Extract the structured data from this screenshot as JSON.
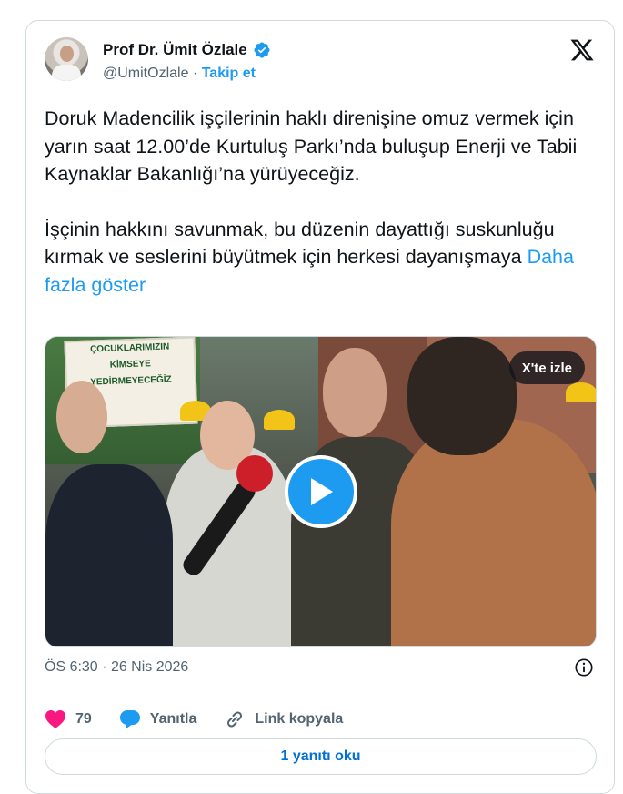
{
  "author": {
    "name": "Prof Dr. Ümit Özlale",
    "handle": "@UmitOzlale",
    "separator": "·",
    "follow_label": "Takip et",
    "verified_icon": "verified-badge-icon"
  },
  "tweet": {
    "paragraph1": "Doruk Madencilik işçilerinin haklı direnişine omuz vermek için yarın saat 12.00’de Kurtuluş Parkı’nda buluşup Enerji ve Tabii Kaynaklar Bakanlığı’na yürüyeceğiz.",
    "paragraph2": "İşçinin hakkını savunmak, bu düzenin dayattığı suskunluğu kırmak ve seslerini büyütmek için herkesi dayanışmaya",
    "show_more": "Daha fazla göster"
  },
  "media": {
    "watch_on_x": "X'te izle",
    "sign_line1": "ÇOCUKLARIMIZIN",
    "sign_line2": "KİMSEYE",
    "sign_line3": "YEDİRMEYECEĞİZ"
  },
  "meta": {
    "time": "ÖS 6:30",
    "dot": "·",
    "date": "26 Nis 2026"
  },
  "actions": {
    "like_count": "79",
    "reply_label": "Yanıtla",
    "copy_link_label": "Link kopyala"
  },
  "read_replies": "1 yanıtı oku",
  "colors": {
    "accent": "#1d9bf0",
    "like": "#f91880",
    "text": "#0f1419",
    "muted": "#536471"
  }
}
